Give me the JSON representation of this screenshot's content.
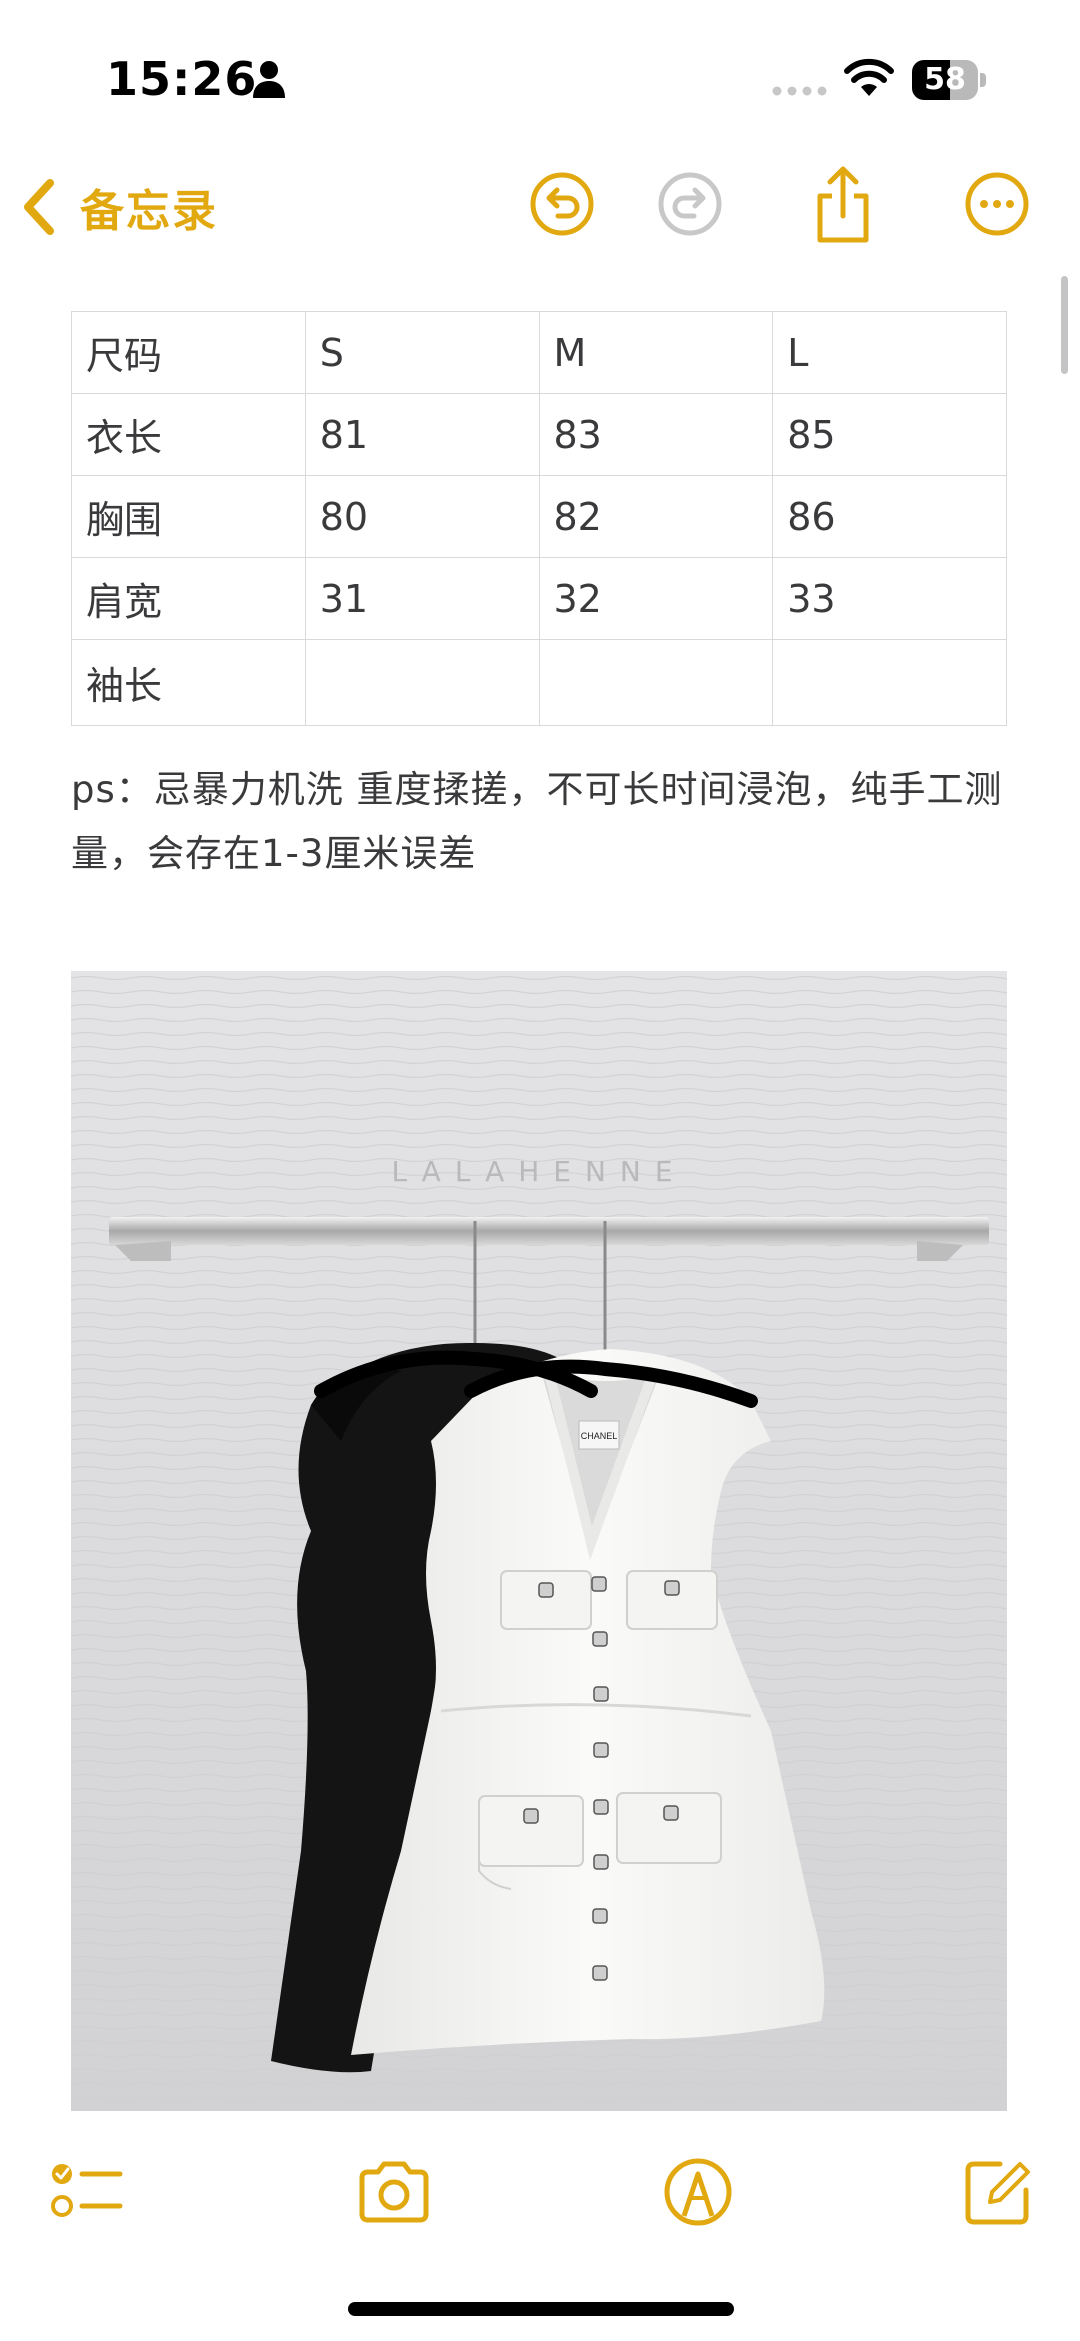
{
  "status_bar": {
    "time": "15:26",
    "battery_percent": "58",
    "battery_level": 0.58
  },
  "nav": {
    "back_label": "备忘录",
    "accent_color": "#e1a80f",
    "icons": [
      "undo-icon",
      "redo-icon",
      "share-icon",
      "more-icon"
    ]
  },
  "size_table": {
    "rows": [
      [
        "尺码",
        "S",
        "M",
        "L"
      ],
      [
        "衣长",
        "81",
        "83",
        "85"
      ],
      [
        "胸围",
        "80",
        "82",
        "86"
      ],
      [
        "肩宽",
        "31",
        "32",
        "33"
      ],
      [
        "袖长",
        "",
        "",
        ""
      ]
    ]
  },
  "note": {
    "text": "ps：忌暴力机洗 重度揉搓，不可长时间浸泡，纯手工测量，会存在1-3厘米误差"
  },
  "photo": {
    "watermark": "LALAHENNE",
    "label_text": "CHANEL"
  },
  "toolbar": {
    "icons": [
      "checklist-icon",
      "camera-icon",
      "markup-icon",
      "compose-icon"
    ]
  }
}
